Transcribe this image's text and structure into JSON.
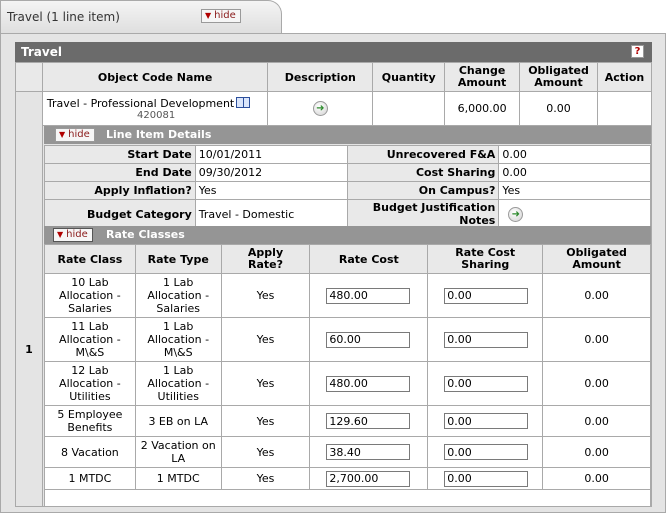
{
  "panel": {
    "tab_title": "Travel (1 line item)",
    "hide_label": "hide",
    "section_title": "Travel",
    "help_glyph": "?"
  },
  "line_items": {
    "columns": [
      "Object Code Name",
      "Description",
      "Quantity",
      "Change Amount",
      "Obligated Amount",
      "Action"
    ],
    "row_number": "1",
    "object_code_name": "Travel - Professional Development",
    "object_code": "420081",
    "quantity": "",
    "change_amount": "6,000.00",
    "obligated_amount": "0.00",
    "action": ""
  },
  "line_item_details": {
    "title": "Line Item Details",
    "hide_label": "hide",
    "start_date_label": "Start Date",
    "start_date": "10/01/2011",
    "end_date_label": "End Date",
    "end_date": "09/30/2012",
    "apply_inflation_label": "Apply Inflation?",
    "apply_inflation": "Yes",
    "budget_category_label": "Budget Category",
    "budget_category": "Travel - Domestic",
    "unrecovered_fa_label": "Unrecovered F&A",
    "unrecovered_fa": "0.00",
    "cost_sharing_label": "Cost Sharing",
    "cost_sharing": "0.00",
    "on_campus_label": "On Campus?",
    "on_campus": "Yes",
    "budget_justification_label_1": "Budget Justification",
    "budget_justification_label_2": "Notes"
  },
  "rate_classes": {
    "title": "Rate Classes",
    "hide_label": "hide",
    "columns": {
      "rate_class": "Rate Class",
      "rate_type": "Rate Type",
      "apply_rate_1": "Apply",
      "apply_rate_2": "Rate?",
      "rate_cost": "Rate Cost",
      "rate_cost_sharing_1": "Rate Cost",
      "rate_cost_sharing_2": "Sharing",
      "obligated_amount_1": "Obligated",
      "obligated_amount_2": "Amount"
    },
    "rows": [
      {
        "rate_class": [
          "10 Lab",
          "Allocation -",
          "Salaries"
        ],
        "rate_type": [
          "1 Lab",
          "Allocation -",
          "Salaries"
        ],
        "apply_rate": "Yes",
        "rate_cost": "480.00",
        "rate_cost_sharing": "0.00",
        "obligated_amount": "0.00"
      },
      {
        "rate_class": [
          "11 Lab",
          "Allocation -",
          "M\\&S"
        ],
        "rate_type": [
          "1 Lab",
          "Allocation -",
          "M\\&S"
        ],
        "apply_rate": "Yes",
        "rate_cost": "60.00",
        "rate_cost_sharing": "0.00",
        "obligated_amount": "0.00"
      },
      {
        "rate_class": [
          "12 Lab",
          "Allocation -",
          "Utilities"
        ],
        "rate_type": [
          "1 Lab",
          "Allocation -",
          "Utilities"
        ],
        "apply_rate": "Yes",
        "rate_cost": "480.00",
        "rate_cost_sharing": "0.00",
        "obligated_amount": "0.00"
      },
      {
        "rate_class": [
          "5 Employee",
          "Benefits"
        ],
        "rate_type": [
          "3 EB on LA"
        ],
        "apply_rate": "Yes",
        "rate_cost": "129.60",
        "rate_cost_sharing": "0.00",
        "obligated_amount": "0.00"
      },
      {
        "rate_class": [
          "8 Vacation"
        ],
        "rate_type": [
          "2 Vacation on",
          "LA"
        ],
        "apply_rate": "Yes",
        "rate_cost": "38.40",
        "rate_cost_sharing": "0.00",
        "obligated_amount": "0.00"
      },
      {
        "rate_class": [
          "1 MTDC"
        ],
        "rate_type": [
          "1 MTDC"
        ],
        "apply_rate": "Yes",
        "rate_cost": "2,700.00",
        "rate_cost_sharing": "0.00",
        "obligated_amount": "0.00"
      }
    ]
  },
  "icons": {
    "go_icon": "go-arrow-icon",
    "lookup_icon": "book-icon",
    "collapse_icon": "triangle-down-icon"
  }
}
